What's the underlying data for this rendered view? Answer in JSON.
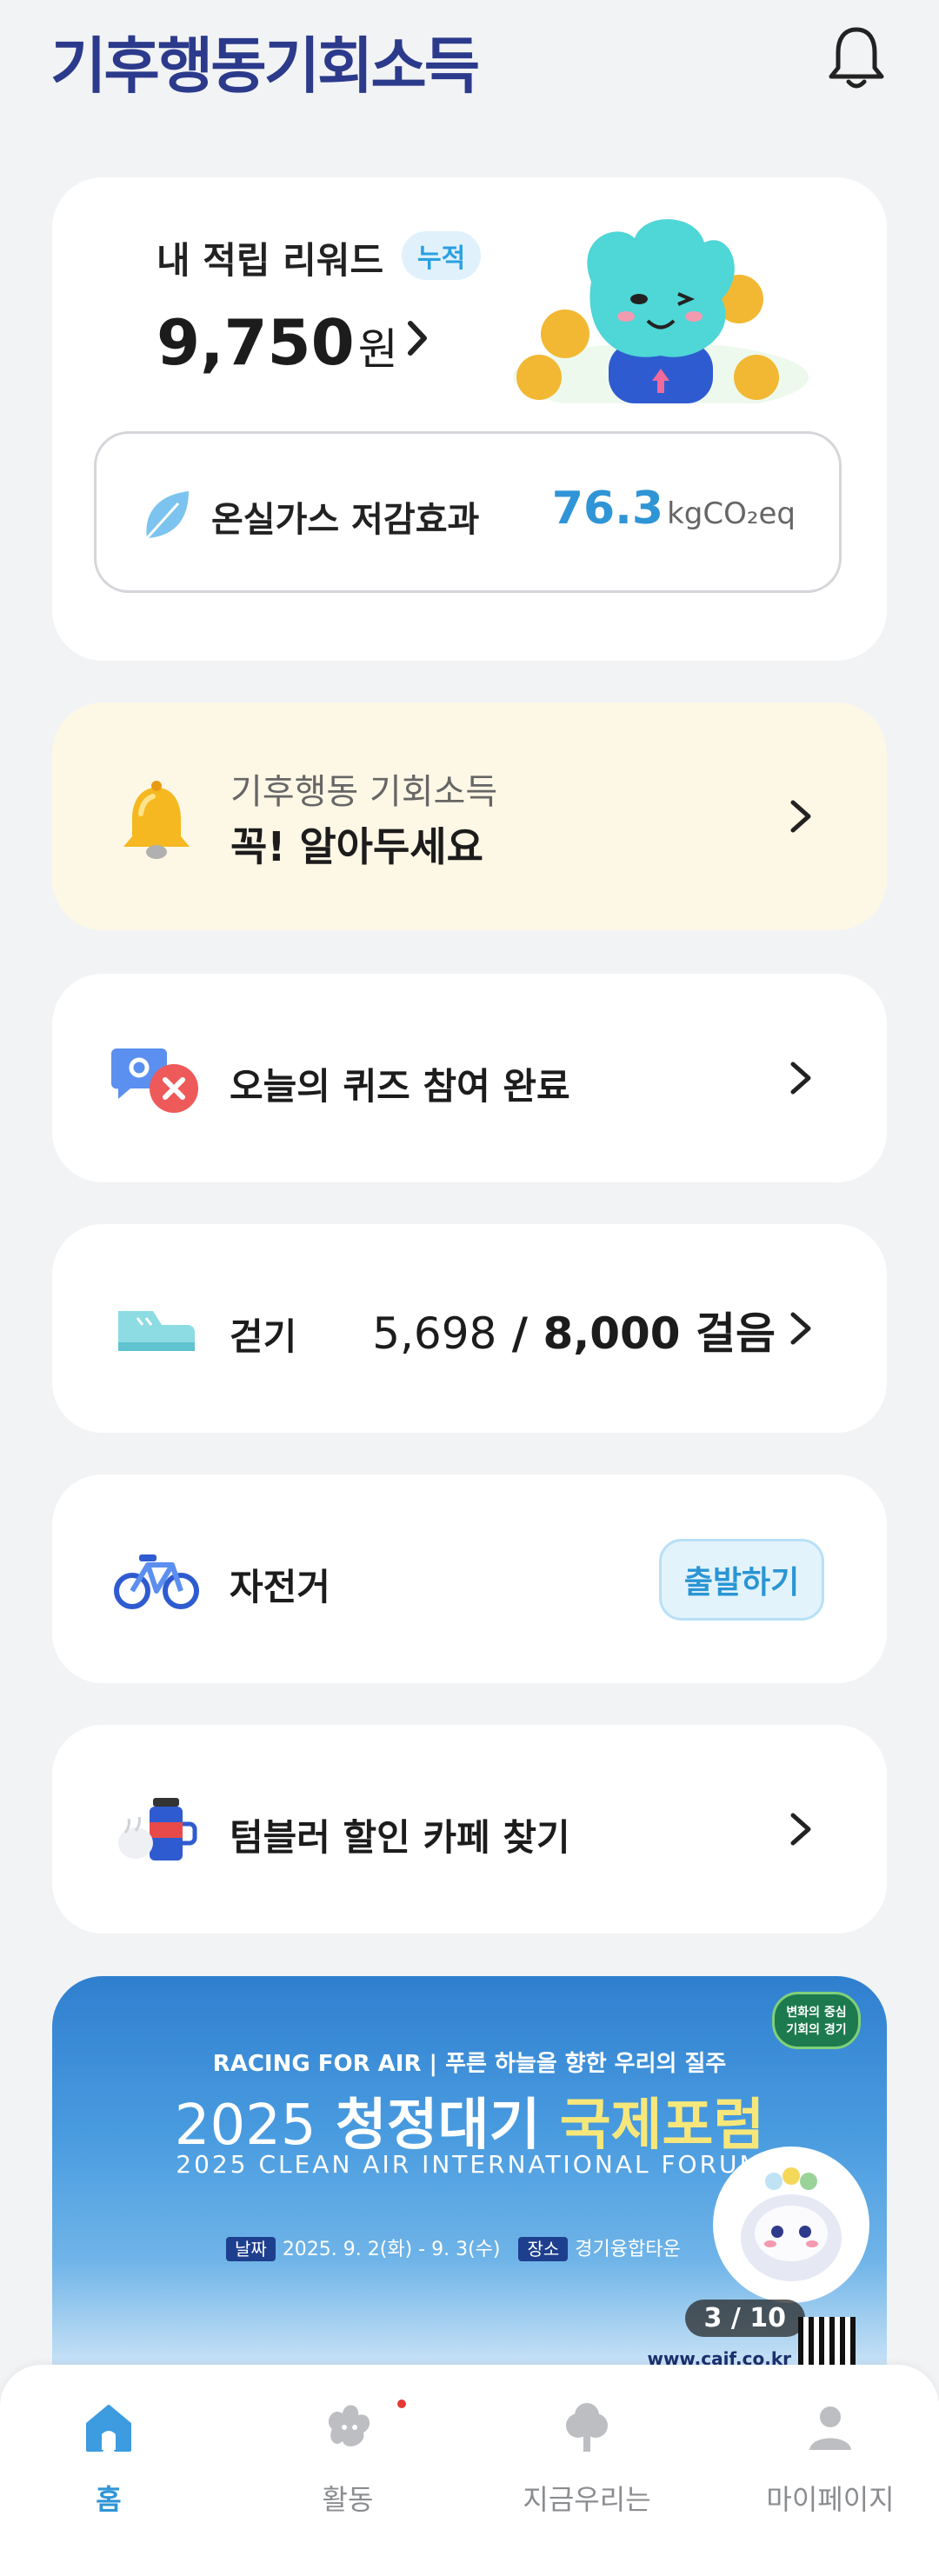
{
  "header": {
    "logo_text": "기후행동기회소득",
    "icons": {
      "notification": "bell-icon"
    }
  },
  "reward": {
    "title": "내 적립 리워드",
    "badge": "누적",
    "amount": "9,750",
    "unit": "원",
    "ghg_label": "온실가스 저감효과",
    "ghg_value": "76.3",
    "ghg_unit": "kgCO₂eq"
  },
  "notice": {
    "subtitle": "기후행동 기회소득",
    "title": "꼭! 알아두세요"
  },
  "activities": {
    "quiz": "오늘의 퀴즈 참여 완료",
    "walk_label": "걷기",
    "walk_current": "5,698",
    "walk_sep": " / ",
    "walk_goal": "8,000 걸음",
    "bike_label": "자전거",
    "bike_button": "출발하기",
    "tumbler": "텀블러 할인 카페 찾기"
  },
  "banner": {
    "kicker": "RACING FOR AIR | 푸른 하늘을 향한 우리의 질주",
    "title_year": "2025",
    "title_main": "청정대기",
    "title_accent": "국제포럼",
    "subtitle": "2025 CLEAN AIR INTERNATIONAL FORUM",
    "date_tag": "날짜",
    "date": "2025. 9. 2(화) - 9. 3(수)",
    "place_tag": "장소",
    "place": "경기융합타운",
    "badge": "변화의 중심 기회의 경기",
    "counter": "3 / 10",
    "url": "www.caif.co.kr"
  },
  "tabs": [
    {
      "label": "홈",
      "icon": "home-icon",
      "active": true
    },
    {
      "label": "활동",
      "icon": "activity-icon",
      "active": false
    },
    {
      "label": "지금우리는",
      "icon": "tree-icon",
      "active": false
    },
    {
      "label": "마이페이지",
      "icon": "person-icon",
      "active": false
    }
  ],
  "colors": {
    "brand": "#2c3a8c",
    "accent": "#2f95d6",
    "notice_bg": "#fdf7e6"
  }
}
